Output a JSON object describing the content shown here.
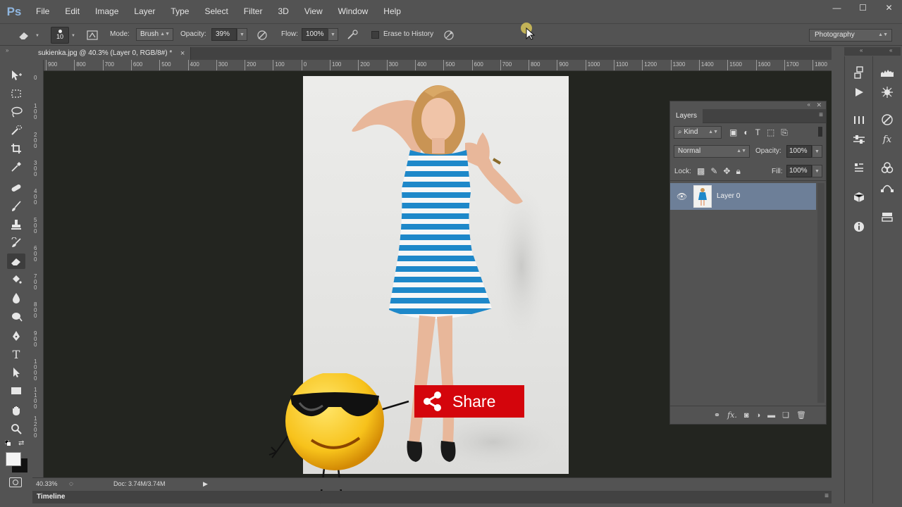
{
  "app": {
    "logo": "Ps"
  },
  "menu": [
    "File",
    "Edit",
    "Image",
    "Layer",
    "Type",
    "Select",
    "Filter",
    "3D",
    "View",
    "Window",
    "Help"
  ],
  "window_controls": {
    "minimize": "—",
    "maximize": "☐",
    "close": "✕"
  },
  "options": {
    "brush_size": "10",
    "mode_label": "Mode:",
    "mode_value": "Brush",
    "opacity_label": "Opacity:",
    "opacity_value": "39%",
    "flow_label": "Flow:",
    "flow_value": "100%",
    "erase_history_label": "Erase to History",
    "workspace": "Photography"
  },
  "document": {
    "tab_title": "sukienka.jpg @ 40.3% (Layer 0, RGB/8#) *",
    "close_glyph": "×",
    "zoom": "40.33%",
    "doc_info": "Doc: 3.74M/3.74M"
  },
  "ruler": {
    "top_labels": [
      "900",
      "800",
      "700",
      "600",
      "500",
      "400",
      "300",
      "200",
      "100",
      "0",
      "100",
      "200",
      "300",
      "400",
      "500",
      "600",
      "700",
      "800",
      "900",
      "1000",
      "1100",
      "1200",
      "1300",
      "1400",
      "1500",
      "1600",
      "1700",
      "1800"
    ],
    "left_labels": [
      "0",
      "1\n0\n0",
      "2\n0\n0",
      "3\n0\n0",
      "4\n0\n0",
      "5\n0\n0",
      "6\n0\n0",
      "7\n0\n0",
      "8\n0\n0",
      "9\n0\n0",
      "1\n0\n0\n0",
      "1\n1\n0\n0",
      "1\n2\n0\n0"
    ]
  },
  "timeline": {
    "label": "Timeline"
  },
  "layers_panel": {
    "tab": "Layers",
    "filter_kind": "Kind",
    "blend_mode": "Normal",
    "opacity_label": "Opacity:",
    "opacity_value": "100%",
    "lock_label": "Lock:",
    "fill_label": "Fill:",
    "fill_value": "100%",
    "layers": [
      {
        "name": "Layer 0",
        "visible": true,
        "selected": true
      }
    ]
  },
  "overlay": {
    "share_label": "Share"
  },
  "colors": {
    "panel_bg": "#535353",
    "canvas_bg": "#232520",
    "selected_layer": "#6d7f98",
    "share_red": "#d4050c",
    "stripe_blue": "#1e88c9"
  },
  "icons": [
    "eraser-icon",
    "brush-preset-icon",
    "airbrush-icon",
    "tablet-pressure-icon",
    "move-icon",
    "marquee-icon",
    "lasso-icon",
    "quick-select-icon",
    "crop-icon",
    "eyedropper-icon",
    "healing-icon",
    "brush-icon",
    "stamp-icon",
    "history-brush-icon",
    "eraser-tool-icon",
    "bucket-icon",
    "blur-icon",
    "dodge-icon",
    "pen-icon",
    "type-icon",
    "path-select-icon",
    "shape-icon",
    "hand-icon",
    "zoom-icon",
    "share-icon",
    "eye-icon"
  ]
}
